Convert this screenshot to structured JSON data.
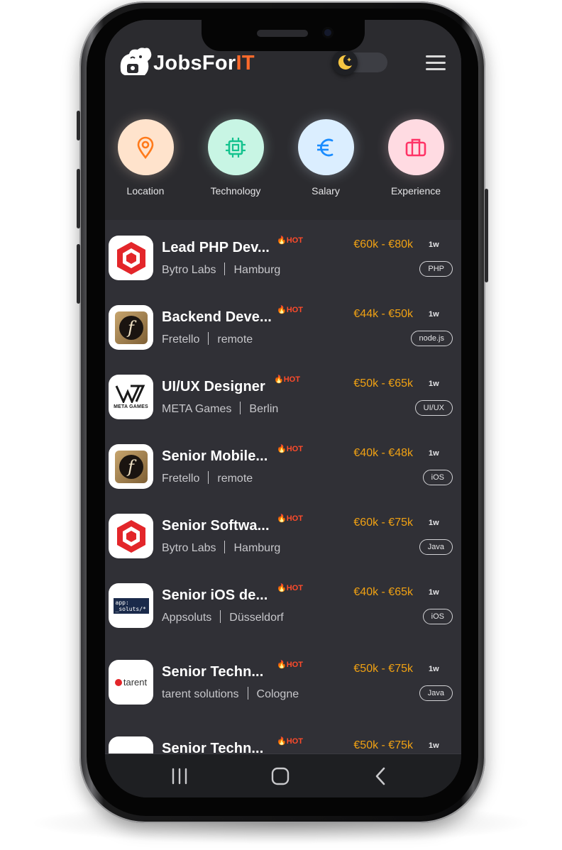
{
  "app": {
    "logo_prefix": "JobsFor",
    "logo_suffix": "IT",
    "theme_mode": "dark"
  },
  "categories": [
    {
      "label": "Location",
      "icon": "location-pin-icon",
      "bg": "#ffe3cc",
      "color": "#ff7a1a"
    },
    {
      "label": "Technology",
      "icon": "chip-icon",
      "bg": "#c8f5e4",
      "color": "#14c38e"
    },
    {
      "label": "Salary",
      "icon": "euro-icon",
      "bg": "#dbeeff",
      "color": "#1a8cff"
    },
    {
      "label": "Experience",
      "icon": "briefcase-icon",
      "bg": "#ffdbe2",
      "color": "#ff3366"
    }
  ],
  "jobs": [
    {
      "title": "Lead PHP Dev...",
      "company": "Bytro Labs",
      "location": "Hamburg",
      "hot": "HOT",
      "salary": "€60k - €80k",
      "age": "1w",
      "tag": "PHP",
      "logo": "bytro"
    },
    {
      "title": "Backend Deve...",
      "company": "Fretello",
      "location": "remote",
      "hot": "HOT",
      "salary": "€44k - €50k",
      "age": "1w",
      "tag": "node.js",
      "logo": "fretello"
    },
    {
      "title": "UI/UX Designer",
      "company": "META Games",
      "location": "Berlin",
      "hot": "HOT",
      "salary": "€50k - €65k",
      "age": "1w",
      "tag": "UI/UX",
      "logo": "meta"
    },
    {
      "title": "Senior Mobile...",
      "company": "Fretello",
      "location": "remote",
      "hot": "HOT",
      "salary": "€40k - €48k",
      "age": "1w",
      "tag": "iOS",
      "logo": "fretello"
    },
    {
      "title": "Senior Softwa...",
      "company": "Bytro Labs",
      "location": "Hamburg",
      "hot": "HOT",
      "salary": "€60k - €75k",
      "age": "1w",
      "tag": "Java",
      "logo": "bytro"
    },
    {
      "title": "Senior iOS de...",
      "company": "Appsoluts",
      "location": "Düsseldorf",
      "hot": "HOT",
      "salary": "€40k - €65k",
      "age": "1w",
      "tag": "iOS",
      "logo": "appsoluts",
      "logo_text": "app: _soluts/*"
    },
    {
      "title": "Senior Techn...",
      "company": "tarent solutions",
      "location": "Cologne",
      "hot": "HOT",
      "salary": "€50k - €75k",
      "age": "1w",
      "tag": "Java",
      "logo": "tarent",
      "logo_text": "tarent"
    },
    {
      "title": "Senior Techn...",
      "company": "",
      "location": "",
      "hot": "HOT",
      "salary": "€50k - €75k",
      "age": "1w",
      "tag": "",
      "logo": "partial"
    }
  ],
  "meta_logo_text": "META GAMES",
  "navbar": [
    "recent-apps-icon",
    "home-icon",
    "back-icon"
  ]
}
